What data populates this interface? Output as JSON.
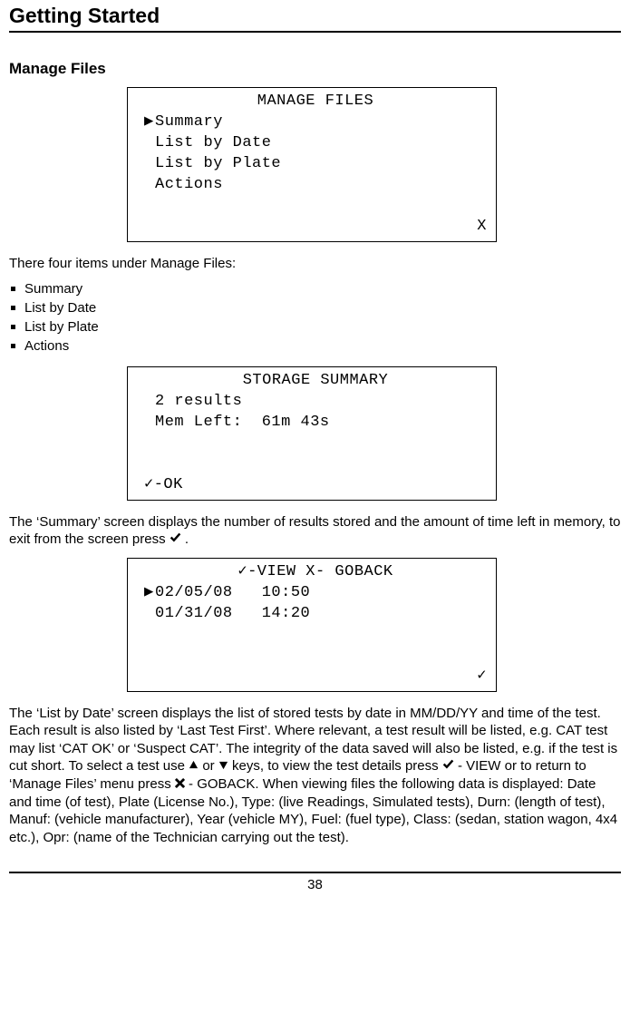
{
  "header": {
    "title": "Getting Started"
  },
  "section": {
    "title": "Manage Files"
  },
  "lcd1": {
    "title": "MANAGE FILES",
    "items": [
      "Summary",
      "List by Date",
      "List by Plate",
      "Actions"
    ],
    "corner": "X"
  },
  "intro_line": "There four items under Manage Files:",
  "bullets": [
    "Summary",
    "List by Date",
    "List by Plate",
    "Actions"
  ],
  "lcd2": {
    "title": "STORAGE SUMMARY",
    "line1": "2 results",
    "line2": "Mem Left:  61m 43s",
    "footer": "✓-OK"
  },
  "para1_a": "The ‘Summary’ screen displays the number of results stored and the amount of time left in memory, to exit from the screen press ",
  "para1_b": " .",
  "lcd3": {
    "title": "✓-VIEW X- GOBACK",
    "row1": "02/05/08   10:50",
    "row2": "01/31/08   14:20",
    "corner": "✓"
  },
  "para2": {
    "t1": "The ‘List by Date’ screen displays the list of stored tests by date in MM/DD/YY and time of the test. Each result is also listed by ‘Last Test First’. Where relevant, a test result will be listed, e.g. CAT test may list ‘CAT OK’ or ‘Suspect CAT’. The integrity of the data saved will also be listed, e.g. if the test is cut short. To select a test use ",
    "t2": " or ",
    "t3": " keys, to view the test details press ",
    "t4": "  - VIEW or to return to ‘Manage Files’ menu press  ",
    "t5": " - GOBACK. When viewing files the following data is displayed: Date and time (of test), Plate (License No.), Type: (live Readings, Simulated tests), Durn: (length of test), Manuf: (vehicle manufacturer), Year (vehicle MY), Fuel: (fuel type), Class: (sedan, station wagon, 4x4 etc.), Opr: (name of the Technician carrying out the test)."
  },
  "page_number": "38"
}
